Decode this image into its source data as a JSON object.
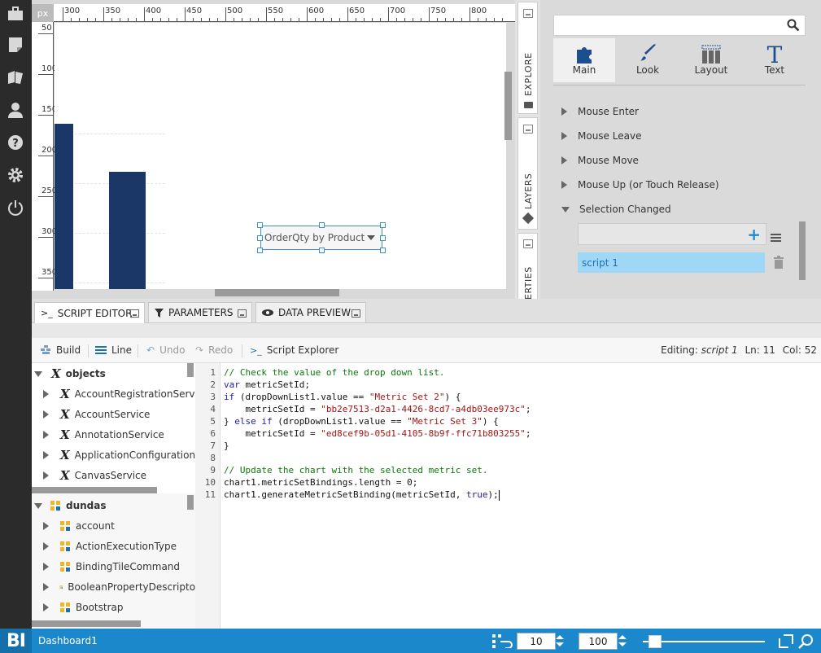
{
  "left_nav": {
    "items": [
      {
        "name": "new-briefcase-icon"
      },
      {
        "name": "open-file-icon"
      },
      {
        "name": "explore-folder-icon"
      },
      {
        "name": "account-icon"
      },
      {
        "name": "help-icon"
      },
      {
        "name": "admin-gear-icon"
      },
      {
        "name": "logout-power-icon"
      }
    ]
  },
  "ruler": {
    "unit": "px",
    "h_ticks": [
      "300",
      "350",
      "400",
      "450",
      "500",
      "550",
      "600",
      "650",
      "700",
      "750",
      "800"
    ],
    "v_ticks": [
      "50",
      "100",
      "150",
      "200",
      "250",
      "300",
      "350"
    ]
  },
  "canvas": {
    "bar_values": [
      0.62,
      0.44
    ],
    "bar_color": "#1b3767",
    "dropdown": {
      "value": "OrderQty by Product"
    }
  },
  "side_tabs": {
    "explore": "EXPLORE",
    "layers": "LAYERS",
    "properties": "ERTIES"
  },
  "properties": {
    "search_placeholder": "",
    "tabs": [
      {
        "label": "Main",
        "icon": "puzzle-icon",
        "active": true
      },
      {
        "label": "Look",
        "icon": "brush-icon",
        "active": false
      },
      {
        "label": "Layout",
        "icon": "layout-icon",
        "active": false
      },
      {
        "label": "Text",
        "icon": "text-t-icon",
        "active": false
      }
    ],
    "events": [
      {
        "label": "Mouse Enter",
        "expanded": false
      },
      {
        "label": "Mouse Leave",
        "expanded": false
      },
      {
        "label": "Mouse Move",
        "expanded": false
      },
      {
        "label": "Mouse Up (or Touch Release)",
        "expanded": false
      },
      {
        "label": "Selection Changed",
        "expanded": true
      }
    ],
    "scripts": [
      "script 1"
    ],
    "accent": "#1d8ad3"
  },
  "bottom_tabs": [
    {
      "label": "SCRIPT EDITOR",
      "icon": "script-icon",
      "active": true
    },
    {
      "label": "PARAMETERS",
      "icon": "filter-icon",
      "active": false
    },
    {
      "label": "DATA PREVIEW",
      "icon": "data-preview-icon",
      "active": false
    }
  ],
  "editor_toolbar": {
    "build": "Build",
    "line": "Line",
    "undo": "Undo",
    "redo": "Redo",
    "script_explorer": "Script Explorer",
    "status_prefix": "Editing:",
    "status_script": "script 1",
    "status_ln_label": "Ln:",
    "status_ln": "11",
    "status_col_label": "Col:",
    "status_col": "52"
  },
  "tree": {
    "section1": {
      "label": "objects",
      "items": [
        "AccountRegistrationService",
        "AccountService",
        "AnnotationService",
        "ApplicationConfigurationService",
        "CanvasService"
      ]
    },
    "section2": {
      "label": "dundas",
      "items": [
        "account",
        "ActionExecutionType",
        "BindingTileCommand",
        "BooleanPropertyDescriptor",
        "Bootstrap"
      ]
    }
  },
  "code": {
    "line_numbers": [
      "1",
      "2",
      "3",
      "4",
      "5",
      "6",
      "7",
      "8",
      "9",
      "10",
      "11"
    ],
    "lines": [
      [
        {
          "t": "com",
          "v": "// Check the value of the drop down list."
        }
      ],
      [
        {
          "t": "kw",
          "v": "var"
        },
        {
          "t": "plain",
          "v": " metricSetId;"
        }
      ],
      [
        {
          "t": "kw",
          "v": "if"
        },
        {
          "t": "plain",
          "v": " (dropDownList1.value == "
        },
        {
          "t": "str",
          "v": "\"Metric Set 2\""
        },
        {
          "t": "plain",
          "v": ") {"
        }
      ],
      [
        {
          "t": "plain",
          "v": "    metricSetId = "
        },
        {
          "t": "str",
          "v": "\"bb2e7513-d2a1-4426-8cd7-a4db03ee973c\""
        },
        {
          "t": "plain",
          "v": ";"
        }
      ],
      [
        {
          "t": "plain",
          "v": "} "
        },
        {
          "t": "kw",
          "v": "else if"
        },
        {
          "t": "plain",
          "v": " (dropDownList1.value == "
        },
        {
          "t": "str",
          "v": "\"Metric Set 3\""
        },
        {
          "t": "plain",
          "v": ") {"
        }
      ],
      [
        {
          "t": "plain",
          "v": "    metricSetId = "
        },
        {
          "t": "str",
          "v": "\"ed8cef9b-05d1-4105-8b9f-ffc71b803255\""
        },
        {
          "t": "plain",
          "v": ";"
        }
      ],
      [
        {
          "t": "plain",
          "v": "}"
        }
      ],
      [
        {
          "t": "plain",
          "v": ""
        }
      ],
      [
        {
          "t": "com",
          "v": "// Update the chart with the selected metric set."
        }
      ],
      [
        {
          "t": "plain",
          "v": "chart1.metricSetBindings.length = 0;"
        }
      ],
      [
        {
          "t": "plain",
          "v": "chart1.generateMetricSetBinding(metricSetId, "
        },
        {
          "t": "kw",
          "v": "true"
        },
        {
          "t": "plain",
          "v": ");"
        }
      ]
    ]
  },
  "footer": {
    "logo": "BI",
    "dashboard_name": "Dashboard1",
    "grid_size": "10",
    "zoom": "100",
    "zoom_fraction": 0.06,
    "bg_color": "#1c88cc"
  }
}
